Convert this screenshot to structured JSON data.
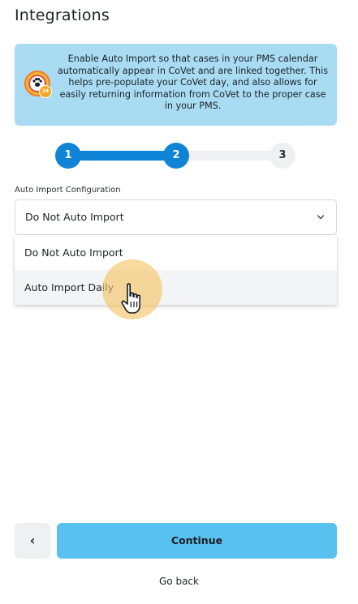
{
  "page": {
    "title": "Integrations"
  },
  "info_banner": {
    "icon": "covet-paw-logo-icon",
    "badge_text": "24",
    "text": "Enable Auto Import so that cases in your PMS calendar automatically appear in CoVet and are linked together. This helps pre-populate your CoVet day, and also allows for easily returning information from CoVet to the proper case in your PMS.",
    "colors": {
      "background": "#a9dcf3",
      "logo_outer": "#f6b730",
      "logo_ring": "#de4b45"
    }
  },
  "stepper": {
    "steps": [
      {
        "label": "1",
        "state": "complete"
      },
      {
        "label": "2",
        "state": "current"
      },
      {
        "label": "3",
        "state": "upcoming"
      }
    ],
    "colors": {
      "active": "#0f84d6",
      "inactive": "#eef0f2"
    }
  },
  "auto_import": {
    "label": "Auto Import Configuration",
    "selected": "Do Not Auto Import",
    "expanded": true,
    "options": [
      "Do Not Auto Import",
      "Auto Import Daily"
    ],
    "hovered_option": "Auto Import Daily"
  },
  "footer": {
    "back_icon": "chevron-left-icon",
    "back_glyph": "‹",
    "continue_label": "Continue",
    "go_back_label": "Go back",
    "colors": {
      "continue": "#58c1ef",
      "back": "#eef0f2"
    }
  }
}
